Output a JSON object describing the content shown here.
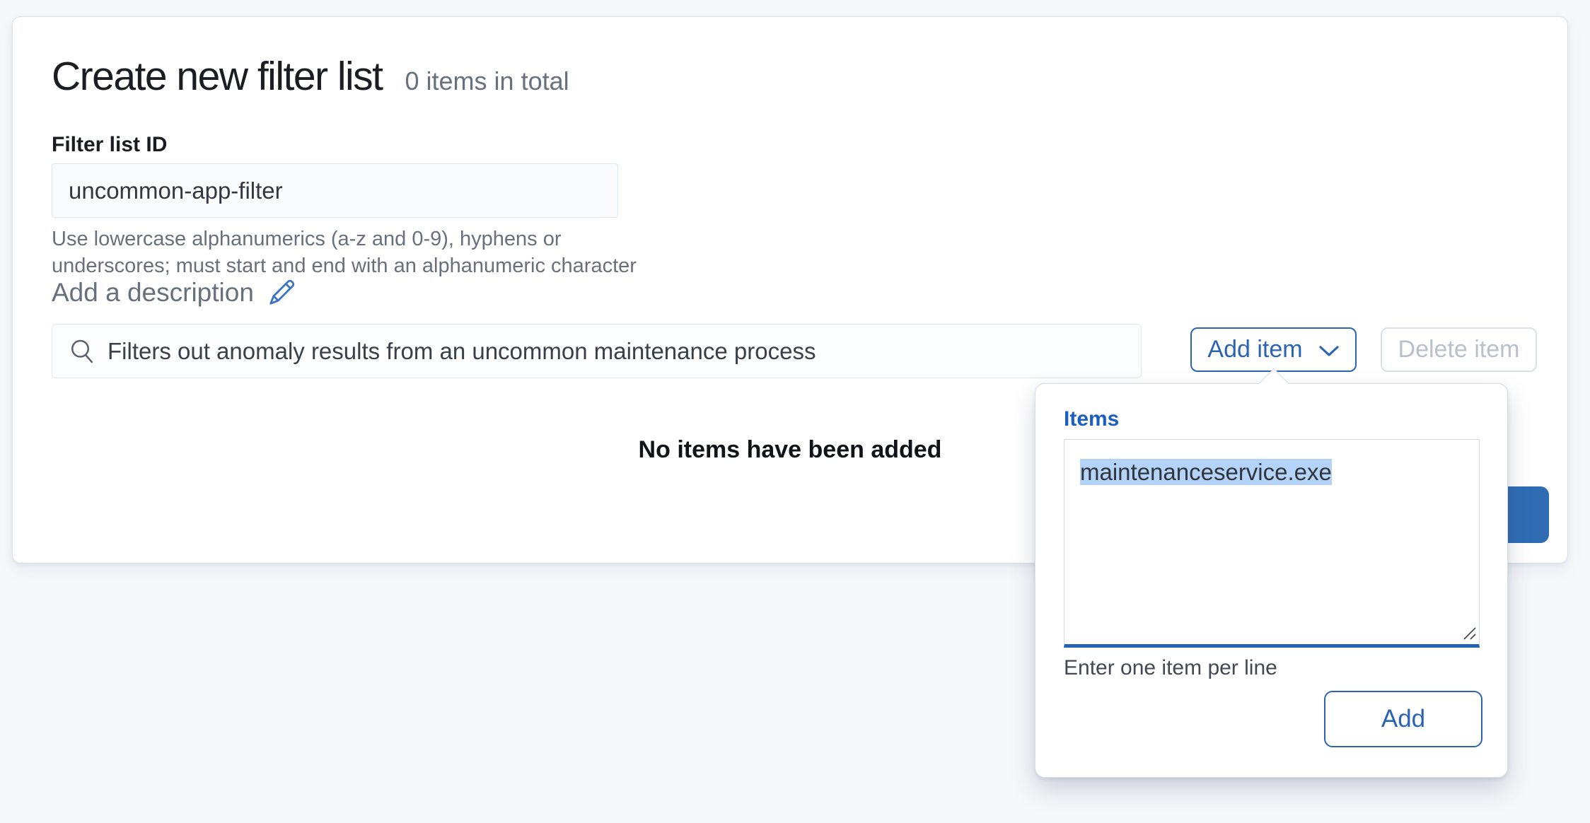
{
  "header": {
    "title": "Create new filter list",
    "item_count": "0 items in total"
  },
  "form": {
    "id_label": "Filter list ID",
    "id_value": "uncommon-app-filter",
    "id_help": "Use lowercase alphanumerics (a-z and 0-9), hyphens or underscores; must start and end with an alphanumeric character",
    "description_link": "Add a description",
    "description_value": "Filters out anomaly results from an uncommon maintenance process"
  },
  "toolbar": {
    "add_item_label": "Add item",
    "delete_item_label": "Delete item"
  },
  "items_list": {
    "empty_message": "No items have been added"
  },
  "popover": {
    "label": "Items",
    "textarea_value": "maintenanceservice.exe",
    "help": "Enter one item per line",
    "add_label": "Add"
  },
  "colors": {
    "accent_blue": "#2a64b2",
    "focused_label_blue": "#1c5dc2",
    "primary_fill_blue": "#2f6cb3",
    "selection_highlight": "#b4d3f8",
    "muted_text": "#69707d",
    "page_background": "#f5f7fa"
  }
}
